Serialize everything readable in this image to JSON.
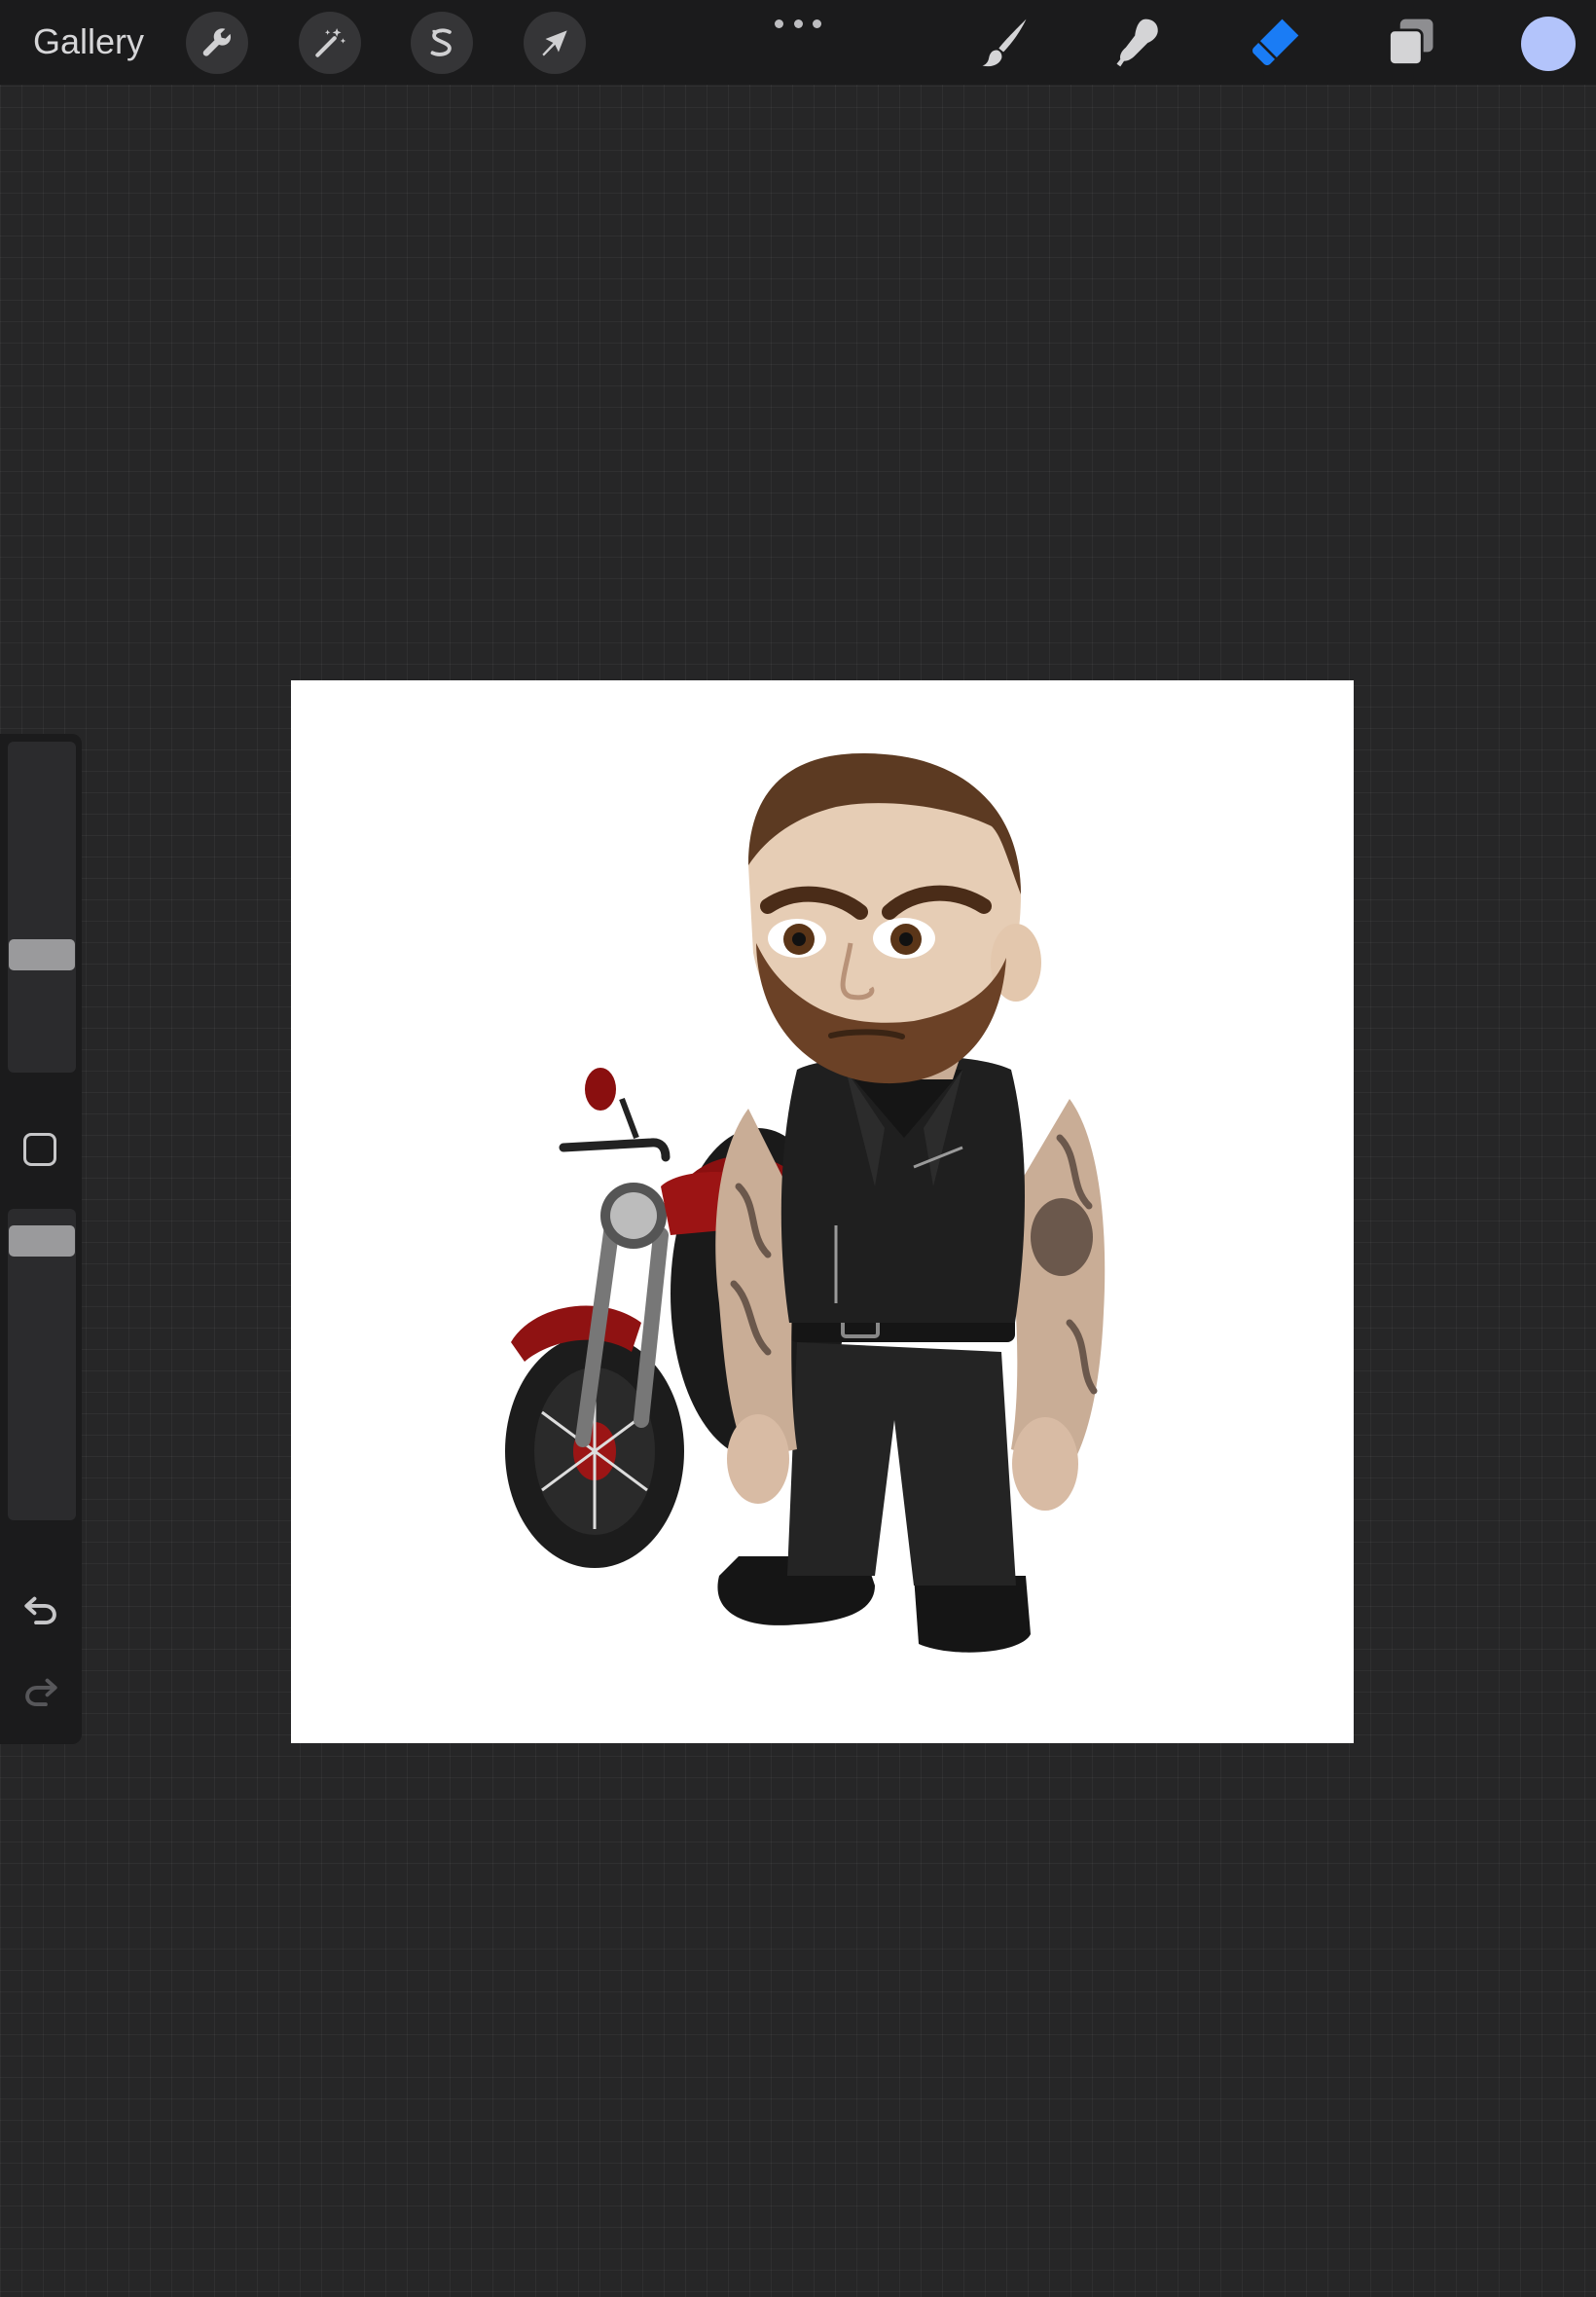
{
  "toolbar": {
    "gallery_label": "Gallery",
    "left_tools": [
      {
        "name": "actions",
        "icon": "wrench-icon"
      },
      {
        "name": "adjustments",
        "icon": "magic-wand-icon"
      },
      {
        "name": "selection",
        "icon": "selection-s-icon"
      },
      {
        "name": "transform",
        "icon": "arrow-cursor-icon"
      }
    ],
    "more_icon": "more-dots-icon",
    "right_tools": [
      {
        "name": "brush",
        "icon": "brush-icon",
        "active": false
      },
      {
        "name": "smudge",
        "icon": "smudge-finger-icon",
        "active": false
      },
      {
        "name": "eraser",
        "icon": "eraser-icon",
        "active": true
      },
      {
        "name": "layers",
        "icon": "layers-icon",
        "active": false
      }
    ],
    "current_color": "#b3c4fb",
    "active_color": "#1a7cf5"
  },
  "sidebar": {
    "brush_size_level": 0.34,
    "opacity_level": 0.94,
    "modify_icon": "square-modify-icon",
    "undo_icon": "undo-icon",
    "redo_icon": "redo-icon",
    "redo_enabled": false
  },
  "canvas": {
    "background": "#ffffff",
    "artwork": "chibi-biker-with-motorcycle"
  }
}
